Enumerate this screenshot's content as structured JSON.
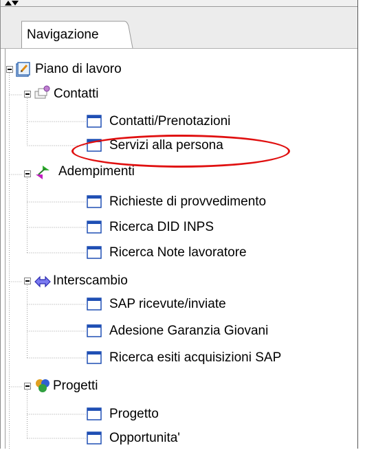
{
  "panel": {
    "tab_label": "Navigazione"
  },
  "tree": {
    "root": {
      "label": "Piano di lavoro",
      "icon": "notepad-icon"
    },
    "groups": [
      {
        "label": "Contatti",
        "icon": "contacts-icon",
        "items": [
          {
            "label": "Contatti/Prenotazioni",
            "icon": "window-icon"
          },
          {
            "label": "Servizi alla persona",
            "icon": "window-icon",
            "highlighted": true
          }
        ]
      },
      {
        "label": "Adempimenti",
        "icon": "arrows-icon",
        "items": [
          {
            "label": "Richieste di provvedimento",
            "icon": "window-icon"
          },
          {
            "label": "Ricerca DID INPS",
            "icon": "window-icon"
          },
          {
            "label": "Ricerca Note lavoratore",
            "icon": "window-icon"
          }
        ]
      },
      {
        "label": "Interscambio",
        "icon": "exchange-icon",
        "items": [
          {
            "label": "SAP ricevute/inviate",
            "icon": "window-icon"
          },
          {
            "label": "Adesione Garanzia Giovani",
            "icon": "window-icon"
          },
          {
            "label": "Ricerca esiti acquisizioni SAP",
            "icon": "window-icon"
          }
        ]
      },
      {
        "label": "Progetti",
        "icon": "projects-icon",
        "items": [
          {
            "label": "Progetto",
            "icon": "window-icon"
          },
          {
            "label": "Opportunita'",
            "icon": "window-icon"
          }
        ]
      }
    ]
  },
  "colors": {
    "highlight": "#e01010",
    "window_icon_blue": "#1f4fb4"
  }
}
